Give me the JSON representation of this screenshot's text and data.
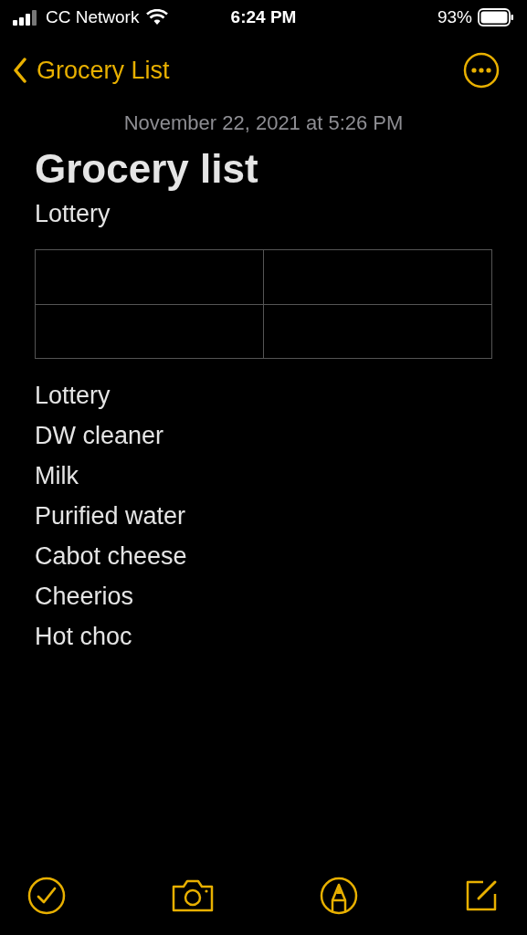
{
  "status_bar": {
    "carrier": "CC Network",
    "time": "6:24 PM",
    "battery": "93%"
  },
  "nav": {
    "back_label": "Grocery List"
  },
  "note": {
    "date": "November 22, 2021 at 5:26 PM",
    "title": "Grocery list",
    "subtitle": "Lottery",
    "table": {
      "rows": [
        [
          {
            "kind": "empty"
          },
          {
            "kind": "empty"
          }
        ],
        [
          {
            "kind": "empty"
          },
          {
            "kind": "empty"
          }
        ]
      ]
    },
    "lines": [
      "Lottery",
      "DW cleaner",
      "Milk",
      "Purified water",
      "Cabot cheese",
      "Cheerios",
      "Hot choc"
    ]
  }
}
